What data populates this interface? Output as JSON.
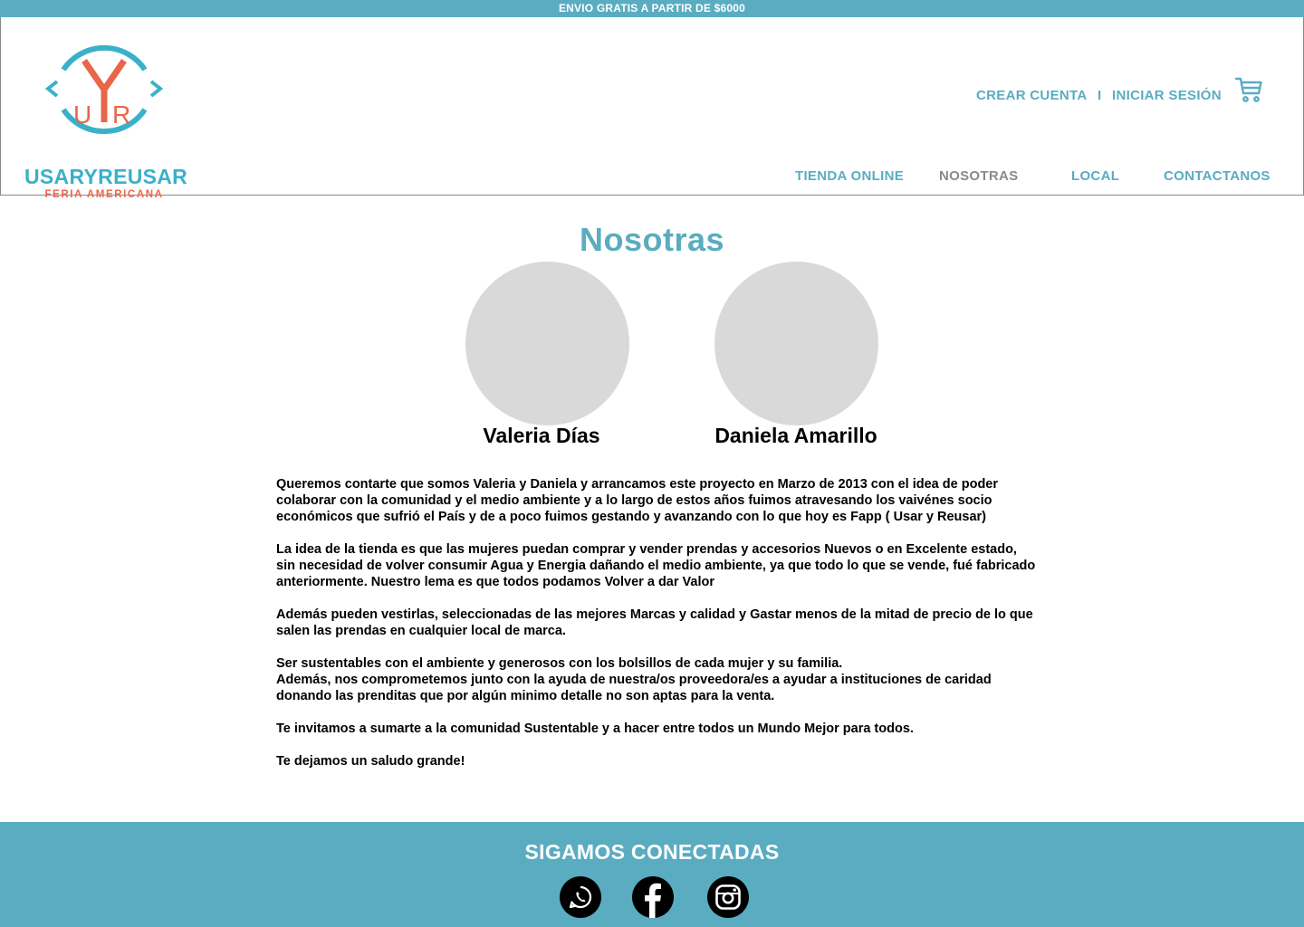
{
  "topbar": {
    "promo_text": "ENVIO GRATIS A PARTIR  DE $6000"
  },
  "brand": {
    "logo_letters": "UYR",
    "name": "USARYREUSAR",
    "tagline": "FERIA AMERICANA",
    "colors": {
      "teal": "#3bb0c9",
      "orange": "#e8674a"
    }
  },
  "account": {
    "create_label": "CREAR CUENTA",
    "separator": "I",
    "login_label": "INICIAR SESIÓN",
    "cart_icon": "cart-icon"
  },
  "nav": {
    "items": [
      {
        "label": "TIENDA ONLINE",
        "active": false
      },
      {
        "label": "NOSOTRAS",
        "active": true
      },
      {
        "label": "LOCAL",
        "active": false
      },
      {
        "label": "CONTACTANOS",
        "active": false
      }
    ]
  },
  "main": {
    "title": "Nosotras",
    "people": [
      {
        "name": "Valeria Días"
      },
      {
        "name": "Daniela Amarillo"
      }
    ],
    "paragraphs": [
      "Queremos contarte que somos Valeria y Daniela y arrancamos este proyecto en Marzo de 2013 con el idea de poder colaborar con la comunidad y el medio ambiente y a lo largo de estos años fuimos atravesando los vaivénes socio económicos que sufrió el País y de a poco  fuimos gestando y avanzando con  lo que hoy es Fapp ( Usar y Reusar)",
      "La idea de la tienda es que las mujeres puedan comprar y vender prendas y accesorios Nuevos o en Excelente estado, sin necesidad de  volver consumir Agua y Energia dañando el medio ambiente, ya que todo lo que se vende, fué fabricado anteriormente. Nuestro lema es que todos podamos Volver a dar Valor",
      "Además pueden vestirlas,  seleccionadas de las mejores Marcas y calidad y Gastar menos de la mitad de precio de lo que salen las prendas en cualquier local de marca.",
      "Ser sustentables con el ambiente y generosos con los bolsillos de cada mujer y su familia.",
      "Además, nos comprometemos junto con la ayuda de nuestra/os proveedora/es a ayudar a  instituciones de caridad donando las prenditas que por algún minimo detalle no son aptas para la venta.",
      "Te invitamos a sumarte a la comunidad Sustentable y a hacer entre todos un Mundo Mejor para todos.",
      "Te dejamos un saludo grande!"
    ]
  },
  "footer": {
    "title": "SIGAMOS CONECTADAS",
    "social": [
      {
        "icon": "whatsapp-icon"
      },
      {
        "icon": "facebook-icon"
      },
      {
        "icon": "instagram-icon"
      }
    ]
  },
  "colors": {
    "accent": "#5aacc1",
    "nav_active": "#8a8a8a",
    "avatar_placeholder": "#d9d9d9"
  }
}
